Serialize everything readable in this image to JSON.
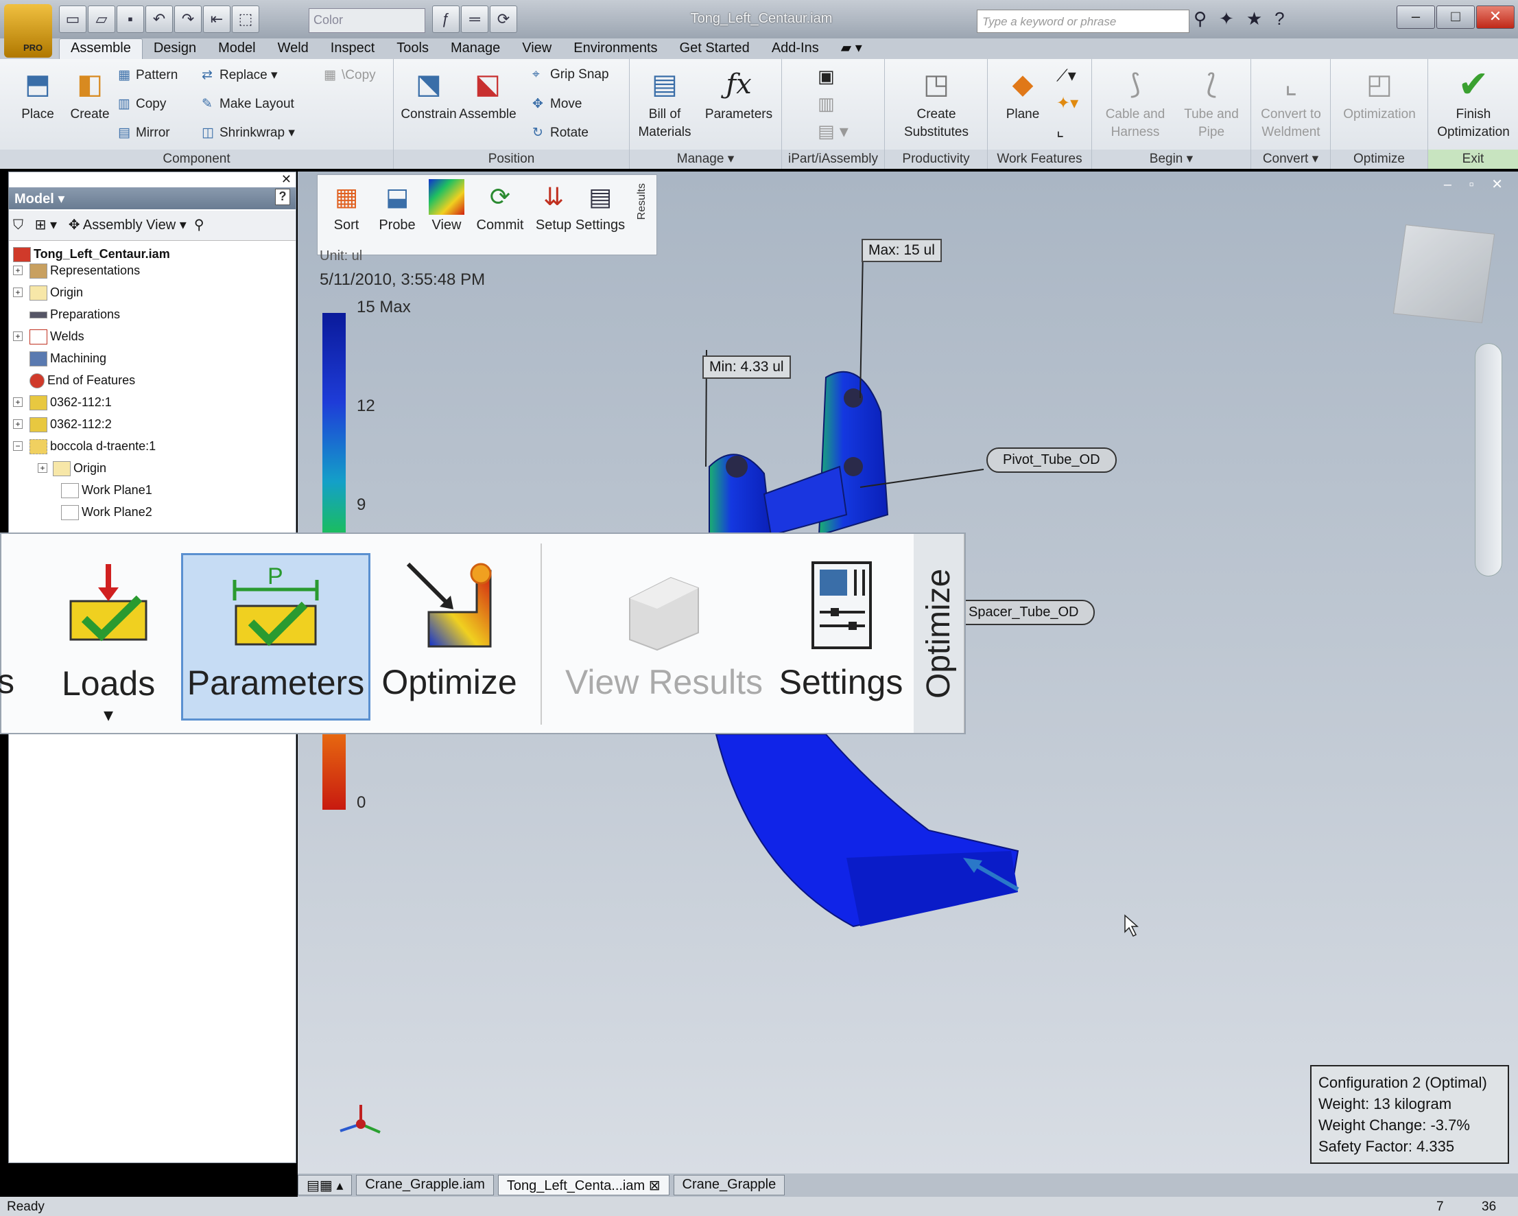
{
  "app": {
    "title": "Tong_Left_Centaur.iam",
    "search_placeholder": "Type a keyword or phrase",
    "pro_label": "PRO",
    "color_box": "Color"
  },
  "tabs": [
    "Assemble",
    "Design",
    "Model",
    "Weld",
    "Inspect",
    "Tools",
    "Manage",
    "View",
    "Environments",
    "Get Started",
    "Add-Ins"
  ],
  "ribbon": {
    "component": {
      "label": "Component",
      "place": "Place",
      "create": "Create",
      "pattern": "Pattern",
      "copy": "Copy",
      "mirror": "Mirror",
      "replace": "Replace",
      "make_layout": "Make Layout",
      "shrinkwrap": "Shrinkwrap",
      "vcopy": "\\Copy"
    },
    "position": {
      "label": "Position",
      "constrain": "Constrain",
      "assemble": "Assemble",
      "grip_snap": "Grip Snap",
      "move": "Move",
      "rotate": "Rotate"
    },
    "manage": {
      "label": "Manage",
      "bom1": "Bill of",
      "bom2": "Materials",
      "parameters": "Parameters"
    },
    "ipart": {
      "label": "iPart/iAssembly"
    },
    "productivity": {
      "label": "Productivity",
      "create1": "Create",
      "create2": "Substitutes"
    },
    "workfeatures": {
      "label": "Work Features",
      "plane": "Plane"
    },
    "begin": {
      "label": "Begin",
      "cable1": "Cable and",
      "cable2": "Harness",
      "tube1": "Tube and",
      "tube2": "Pipe"
    },
    "convert": {
      "label": "Convert",
      "c1": "Convert to",
      "c2": "Weldment"
    },
    "optimize": {
      "label": "Optimize",
      "opt": "Optimization"
    },
    "exit": {
      "label": "Exit",
      "f1": "Finish",
      "f2": "Optimization"
    }
  },
  "browser": {
    "header": "Model",
    "view_label": "Assembly View",
    "nodes": [
      "Tong_Left_Centaur.iam",
      "Representations",
      "Origin",
      "Preparations",
      "Welds",
      "Machining",
      "End of Features",
      "0362-112:1",
      "0362-112:2",
      "boccola d-traente:1",
      "Origin",
      "Work Plane1",
      "Work Plane2"
    ]
  },
  "results_panel": {
    "sort": "Sort",
    "probe": "Probe",
    "view": "View",
    "commit": "Commit",
    "setup": "Setup",
    "settings": "Settings",
    "vertical": "Results"
  },
  "legend": {
    "header": "Unit: ul",
    "date": "5/11/2010, 3:55:48 PM",
    "max": "15 Max",
    "t12": "12",
    "t9": "9",
    "t0": "0"
  },
  "callouts": {
    "max": "Max: 15 ul",
    "min": "Min: 4.33 ul",
    "pivot": "Pivot_Tube_OD",
    "spacer": "Spacer_Tube_OD"
  },
  "zoom": {
    "cut": "s",
    "loads": "Loads",
    "parameters": "Parameters",
    "optimize": "Optimize",
    "view_results": "View Results",
    "settings": "Settings",
    "vertical": "Optimize"
  },
  "info": {
    "line1": "Configuration 2 (Optimal)",
    "line2": "Weight: 13 kilogram",
    "line3": "Weight Change: -3.7%",
    "line4": "Safety Factor: 4.335"
  },
  "doc_tabs": [
    "Crane_Grapple.iam",
    "Tong_Left_Centa...iam",
    "Crane_Grapple"
  ],
  "status": {
    "text": "Ready",
    "n1": "7",
    "n2": "36"
  }
}
